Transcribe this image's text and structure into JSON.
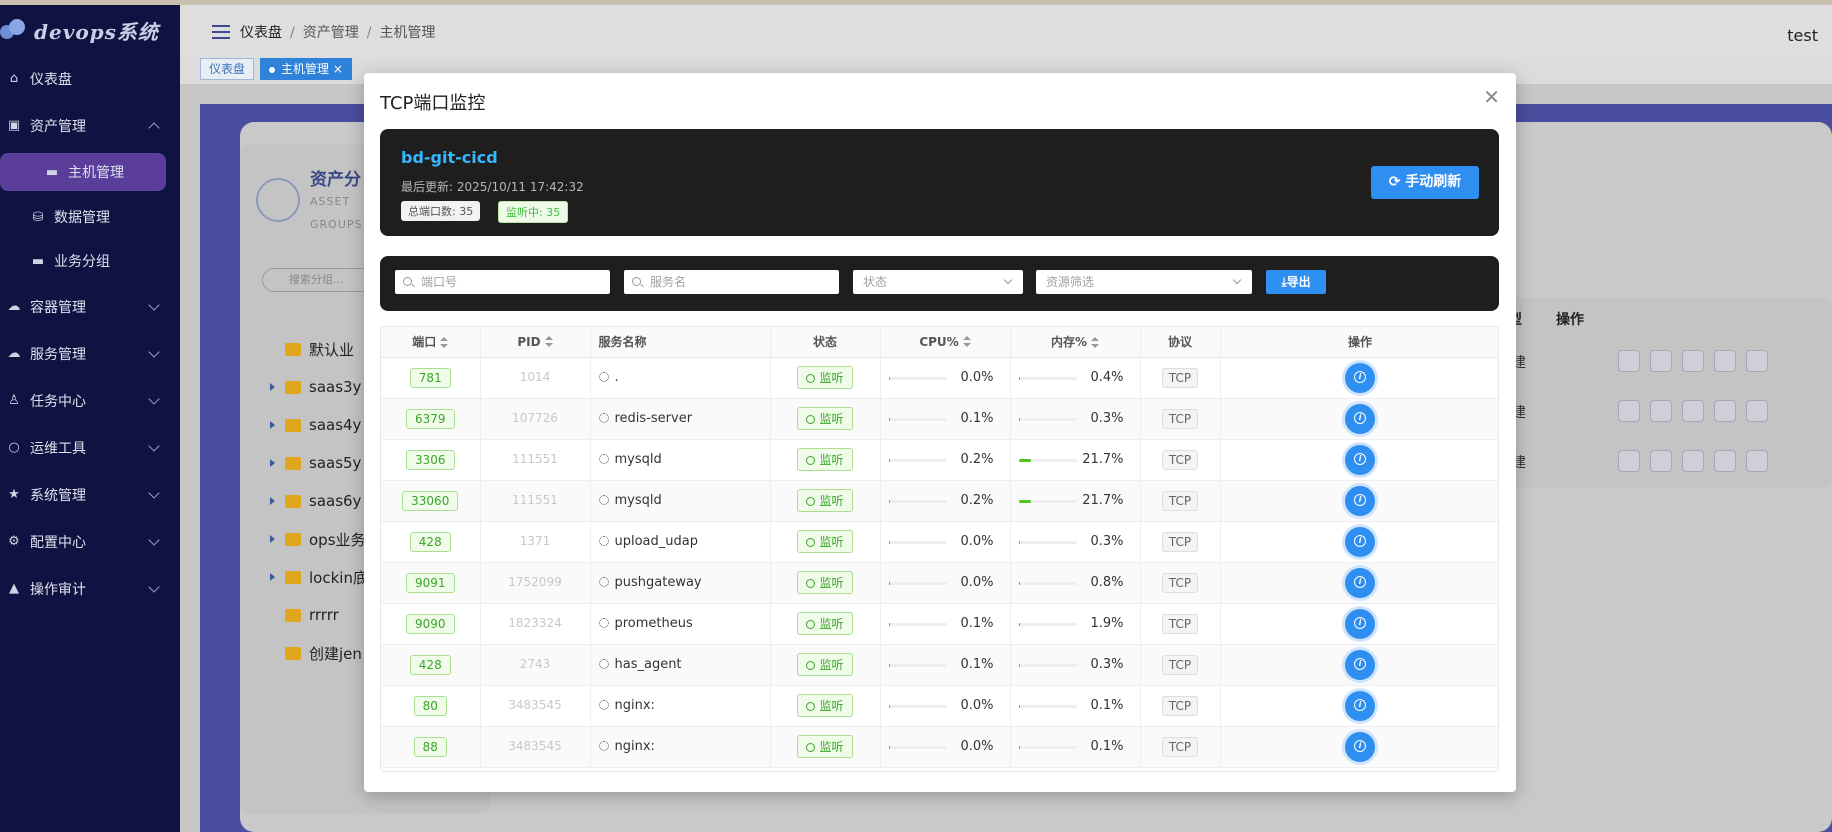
{
  "app": {
    "logo_text": "devops系统",
    "user": "test"
  },
  "sidebar": {
    "items": [
      {
        "label": "仪表盘",
        "icon": "home-icon",
        "type": "top"
      },
      {
        "label": "资产管理",
        "icon": "chart-icon",
        "type": "group-open"
      },
      {
        "label": "主机管理",
        "icon": "monitor-icon",
        "type": "sub-active"
      },
      {
        "label": "数据管理",
        "icon": "database-icon",
        "type": "sub"
      },
      {
        "label": "业务分组",
        "icon": "monitor-icon",
        "type": "sub"
      },
      {
        "label": "容器管理",
        "icon": "cloud-icon",
        "type": "group"
      },
      {
        "label": "服务管理",
        "icon": "cloud-icon",
        "type": "group"
      },
      {
        "label": "任务中心",
        "icon": "user-icon",
        "type": "group"
      },
      {
        "label": "运维工具",
        "icon": "search-icon",
        "type": "group"
      },
      {
        "label": "系统管理",
        "icon": "star-icon",
        "type": "group"
      },
      {
        "label": "配置中心",
        "icon": "gear-icon",
        "type": "group"
      },
      {
        "label": "操作审计",
        "icon": "bell-icon",
        "type": "group"
      }
    ]
  },
  "header": {
    "breadcrumb": [
      "仪表盘",
      "资产管理",
      "主机管理"
    ]
  },
  "tabs": [
    {
      "label": "仪表盘"
    },
    {
      "label": "主机管理"
    }
  ],
  "background": {
    "panel_title": "资产分",
    "panel_sub1": "ASSET",
    "panel_sub2": "GROUPS",
    "search_placeholder": "搜索分组...",
    "tree": [
      {
        "label": "默认业",
        "arrow": false
      },
      {
        "label": "saas3y",
        "arrow": true
      },
      {
        "label": "saas4y",
        "arrow": true
      },
      {
        "label": "saas5y",
        "arrow": true
      },
      {
        "label": "saas6y",
        "arrow": true
      },
      {
        "label": "ops业务",
        "arrow": true
      },
      {
        "label": "lockin底",
        "arrow": true
      },
      {
        "label": "rrrrr",
        "arrow": false
      },
      {
        "label": "创建jen",
        "arrow": false
      }
    ],
    "table_headers": [
      "型",
      "操作"
    ],
    "rows": [
      "建",
      "建",
      "建"
    ]
  },
  "modal": {
    "title": "TCP端口监控",
    "host": "bd-git-cicd",
    "updated": "最后更新: 2025/10/11 17:42:32",
    "total_ports": "总端口数: 35",
    "listening": "监听中: 35",
    "refresh_label": "手动刷新",
    "filters": {
      "port_placeholder": "端口号",
      "service_placeholder": "服务名",
      "status_placeholder": "状态",
      "resource_placeholder": "资源筛选",
      "export_label": "导出"
    },
    "columns": [
      "端口",
      "PID",
      "服务名称",
      "状态",
      "CPU%",
      "内存%",
      "协议",
      "操作"
    ],
    "rows": [
      {
        "port": "781",
        "pid": "1014",
        "service": ".",
        "status": "监听",
        "cpu": "0.0%",
        "cpu_v": 0.0,
        "mem": "0.4%",
        "mem_v": 0.4,
        "protocol": "TCP"
      },
      {
        "port": "6379",
        "pid": "107726",
        "service": "redis-server",
        "status": "监听",
        "cpu": "0.1%",
        "cpu_v": 0.1,
        "mem": "0.3%",
        "mem_v": 0.3,
        "protocol": "TCP"
      },
      {
        "port": "3306",
        "pid": "111551",
        "service": "mysqld",
        "status": "监听",
        "cpu": "0.2%",
        "cpu_v": 0.2,
        "mem": "21.7%",
        "mem_v": 21.7,
        "protocol": "TCP"
      },
      {
        "port": "33060",
        "pid": "111551",
        "service": "mysqld",
        "status": "监听",
        "cpu": "0.2%",
        "cpu_v": 0.2,
        "mem": "21.7%",
        "mem_v": 21.7,
        "protocol": "TCP"
      },
      {
        "port": "428",
        "pid": "1371",
        "service": "upload_udap",
        "status": "监听",
        "cpu": "0.0%",
        "cpu_v": 0.0,
        "mem": "0.3%",
        "mem_v": 0.3,
        "protocol": "TCP"
      },
      {
        "port": "9091",
        "pid": "1752099",
        "service": "pushgateway",
        "status": "监听",
        "cpu": "0.0%",
        "cpu_v": 0.0,
        "mem": "0.8%",
        "mem_v": 0.8,
        "protocol": "TCP"
      },
      {
        "port": "9090",
        "pid": "1823324",
        "service": "prometheus",
        "status": "监听",
        "cpu": "0.1%",
        "cpu_v": 0.1,
        "mem": "1.9%",
        "mem_v": 1.9,
        "protocol": "TCP"
      },
      {
        "port": "428",
        "pid": "2743",
        "service": "has_agent",
        "status": "监听",
        "cpu": "0.1%",
        "cpu_v": 0.1,
        "mem": "0.3%",
        "mem_v": 0.3,
        "protocol": "TCP"
      },
      {
        "port": "80",
        "pid": "3483545",
        "service": "nginx:",
        "status": "监听",
        "cpu": "0.0%",
        "cpu_v": 0.0,
        "mem": "0.1%",
        "mem_v": 0.1,
        "protocol": "TCP"
      },
      {
        "port": "88",
        "pid": "3483545",
        "service": "nginx:",
        "status": "监听",
        "cpu": "0.0%",
        "cpu_v": 0.0,
        "mem": "0.1%",
        "mem_v": 0.1,
        "protocol": "TCP"
      }
    ]
  },
  "colors": {
    "sidebar_bg": "#101342",
    "accent": "#2f8ff0",
    "host_name": "#35b8ff",
    "success": "#3aa62a",
    "active_menu": "#5b3e9a"
  }
}
